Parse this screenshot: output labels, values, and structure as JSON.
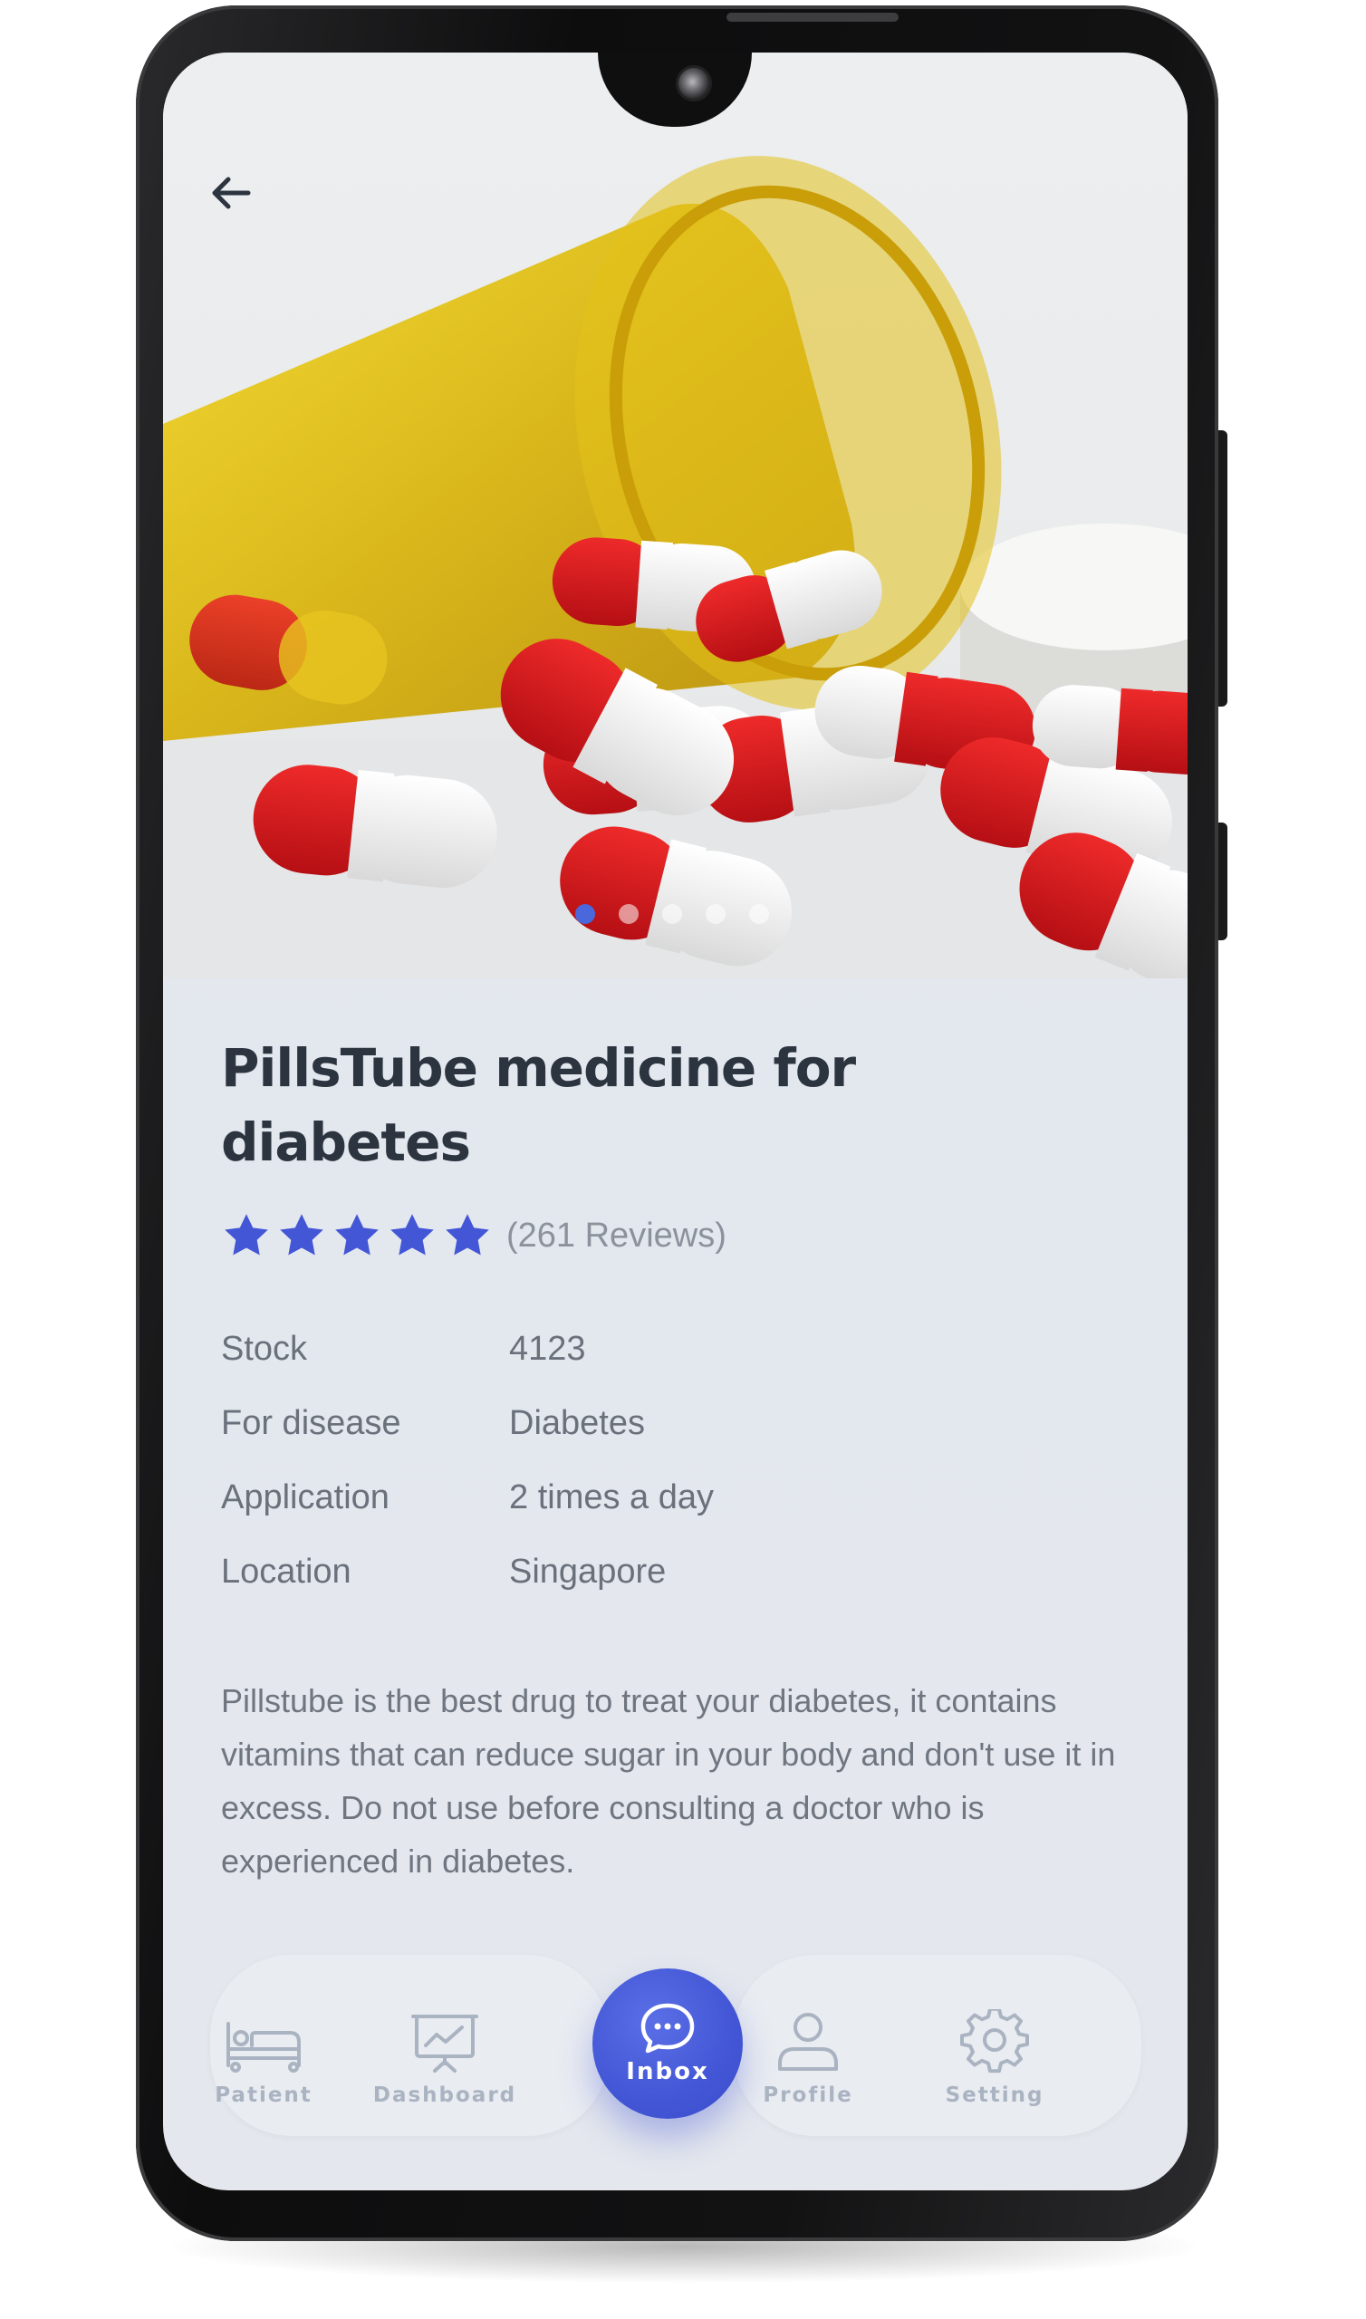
{
  "product": {
    "title": "PillsTube medicine for diabetes",
    "rating": 5,
    "reviews": "(261 Reviews)",
    "specs": [
      {
        "label": "Stock",
        "value": "4123"
      },
      {
        "label": "For disease",
        "value": "Diabetes"
      },
      {
        "label": "Application",
        "value": "2 times a day"
      },
      {
        "label": "Location",
        "value": "Singapore"
      }
    ],
    "description": "Pillstube is the best drug to treat your diabetes, it contains vitamins that can reduce sugar in your body and don't use it in excess. Do not use before consulting a doctor who is experienced in diabetes."
  },
  "carousel": {
    "slides": 5,
    "active_index": 0
  },
  "nav": {
    "items": [
      {
        "label": "Patient",
        "icon": "bed-icon"
      },
      {
        "label": "Dashboard",
        "icon": "presentation-chart-icon"
      },
      {
        "label": "Inbox",
        "icon": "chat-bubble-icon",
        "active": true
      },
      {
        "label": "Profile",
        "icon": "user-icon"
      },
      {
        "label": "Setting",
        "icon": "gear-icon"
      }
    ]
  },
  "colors": {
    "accent": "#4356d6",
    "star": "#4356d6",
    "nav_inactive": "#aab3c1",
    "title": "#2c3440"
  }
}
